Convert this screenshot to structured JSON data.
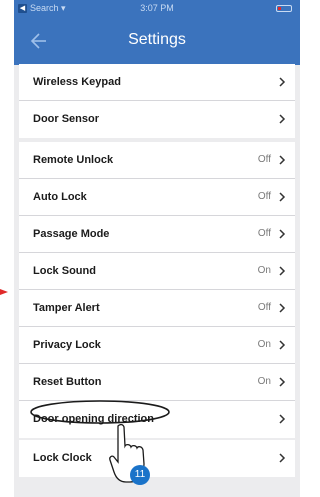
{
  "status_bar": {
    "back_glyph": "◀",
    "carrier": "Search  ▾",
    "time": "3:07 PM"
  },
  "nav": {
    "title": "Settings",
    "back_icon": "arrow-left-icon"
  },
  "groups": [
    {
      "rows": [
        {
          "label": "Wireless Keypad",
          "value": ""
        },
        {
          "label": "Door Sensor",
          "value": ""
        }
      ]
    },
    {
      "rows": [
        {
          "label": "Remote Unlock",
          "value": "Off"
        },
        {
          "label": "Auto Lock",
          "value": "Off"
        },
        {
          "label": "Passage Mode",
          "value": "Off"
        },
        {
          "label": "Lock Sound",
          "value": "On"
        },
        {
          "label": "Tamper Alert",
          "value": "Off"
        },
        {
          "label": "Privacy Lock",
          "value": "On"
        },
        {
          "label": "Reset Button",
          "value": "On"
        },
        {
          "label": "Door opening direction",
          "value": ""
        }
      ]
    },
    {
      "rows": [
        {
          "label": "Lock Clock",
          "value": ""
        }
      ]
    }
  ],
  "callout": {
    "step_number": "11",
    "pointer_icon": "hand-pointer-icon"
  },
  "colors": {
    "accent": "#3b73bd",
    "badge": "#1a73c9",
    "highlight_stroke": "#1b1b1b",
    "side_arrow": "#e02a2a"
  }
}
